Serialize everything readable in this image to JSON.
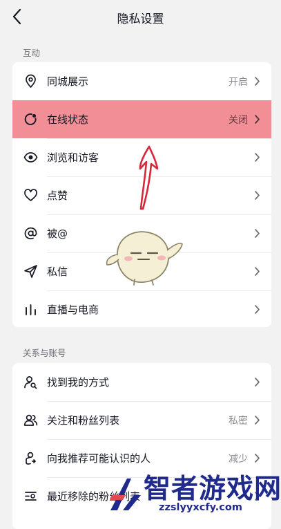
{
  "header": {
    "title": "隐私设置"
  },
  "sections": [
    {
      "label": "互动",
      "items": [
        {
          "label": "同城展示",
          "value": "开启",
          "icon": "location-pin-icon"
        },
        {
          "label": "在线状态",
          "value": "关闭",
          "icon": "online-status-icon",
          "highlighted": true
        },
        {
          "label": "浏览和访客",
          "value": "",
          "icon": "eye-icon"
        },
        {
          "label": "点赞",
          "value": "",
          "icon": "heart-icon"
        },
        {
          "label": "被@",
          "value": "",
          "icon": "at-sign-icon"
        },
        {
          "label": "私信",
          "value": "",
          "icon": "paper-plane-icon"
        },
        {
          "label": "直播与电商",
          "value": "",
          "icon": "bar-chart-icon"
        }
      ]
    },
    {
      "label": "关系与账号",
      "items": [
        {
          "label": "找到我的方式",
          "value": "",
          "icon": "find-user-icon"
        },
        {
          "label": "关注和粉丝列表",
          "value": "私密",
          "icon": "users-icon"
        },
        {
          "label": "向我推荐可能认识的人",
          "value": "减少",
          "icon": "recommend-user-icon"
        },
        {
          "label": "最近移除的粉丝列表",
          "value": "",
          "icon": "list-icon"
        }
      ]
    }
  ],
  "watermark": {
    "text": "智者游戏网",
    "url": "zzslyyxcfy.com"
  },
  "colors": {
    "highlight": "#f28f96",
    "background": "#f2f2f3",
    "watermark": "#1f2a8c",
    "annotation_arrow": "#d6283a"
  }
}
